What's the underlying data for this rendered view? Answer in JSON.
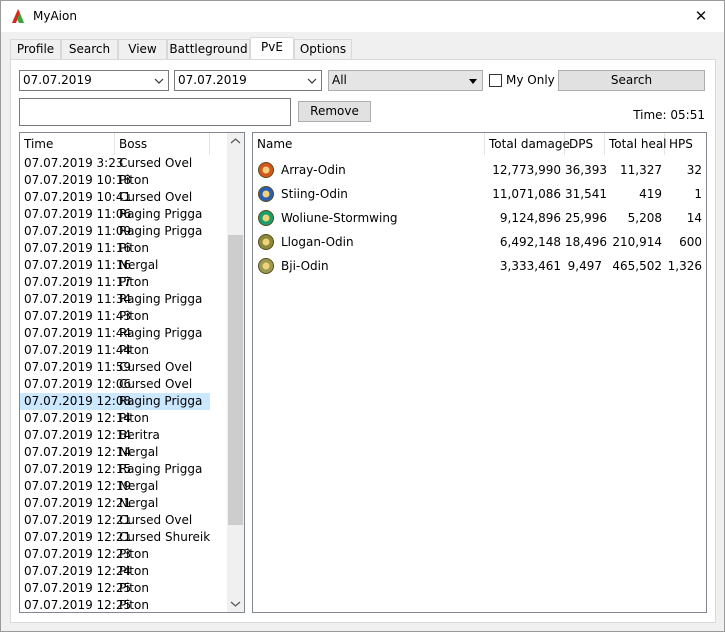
{
  "window": {
    "title": "MyAion",
    "close_glyph": "✕"
  },
  "tabs": [
    {
      "label": "Profile"
    },
    {
      "label": "Search"
    },
    {
      "label": "View"
    },
    {
      "label": "Battleground"
    },
    {
      "label": "PvE"
    },
    {
      "label": "Options"
    }
  ],
  "active_tab": "PvE",
  "filters": {
    "date_from": "07.07.2019",
    "date_to": "07.07.2019",
    "boss_filter": "All",
    "my_only_label": "My Only",
    "my_only_checked": false,
    "search_label": "Search",
    "remove_label": "Remove",
    "text_value": "",
    "time_label": "Time: 05:51"
  },
  "fight_list": {
    "headers": [
      "Time",
      "Boss"
    ],
    "sort_indicator": "˄",
    "selected_index": 14,
    "rows": [
      [
        "07.07.2019 3:23",
        "Cursed Ovel"
      ],
      [
        "07.07.2019 10:18",
        "Piton"
      ],
      [
        "07.07.2019 10:41",
        "Cursed Ovel"
      ],
      [
        "07.07.2019 11:06",
        "Raging Prigga"
      ],
      [
        "07.07.2019 11:09",
        "Raging Prigga"
      ],
      [
        "07.07.2019 11:16",
        "Piton"
      ],
      [
        "07.07.2019 11:16",
        "Nergal"
      ],
      [
        "07.07.2019 11:17",
        "Piton"
      ],
      [
        "07.07.2019 11:34",
        "Raging Prigga"
      ],
      [
        "07.07.2019 11:43",
        "Piton"
      ],
      [
        "07.07.2019 11:44",
        "Raging Prigga"
      ],
      [
        "07.07.2019 11:44",
        "Piton"
      ],
      [
        "07.07.2019 11:59",
        "Cursed Ovel"
      ],
      [
        "07.07.2019 12:06",
        "Cursed Ovel"
      ],
      [
        "07.07.2019 12:08",
        "Raging Prigga"
      ],
      [
        "07.07.2019 12:14",
        "Piton"
      ],
      [
        "07.07.2019 12:14",
        "Beritra"
      ],
      [
        "07.07.2019 12:14",
        "Nergal"
      ],
      [
        "07.07.2019 12:15",
        "Raging Prigga"
      ],
      [
        "07.07.2019 12:19",
        "Nergal"
      ],
      [
        "07.07.2019 12:21",
        "Nergal"
      ],
      [
        "07.07.2019 12:21",
        "Cursed Ovel"
      ],
      [
        "07.07.2019 12:21",
        "Cursed Shureik"
      ],
      [
        "07.07.2019 12:23",
        "Piton"
      ],
      [
        "07.07.2019 12:24",
        "Piton"
      ],
      [
        "07.07.2019 12:25",
        "Piton"
      ],
      [
        "07.07.2019 12:25",
        "Piton"
      ]
    ],
    "scroll_position": 0.55
  },
  "stats": {
    "headers": [
      "Name",
      "Total damage",
      "DPS",
      "Total heal",
      "HPS"
    ],
    "rows": [
      {
        "icon": "assassin-class-icon",
        "color": "#d4581e",
        "name": "Array-Odin",
        "damage": "12,773,990",
        "dps": "36,393",
        "heal": "11,327",
        "hps": "32"
      },
      {
        "icon": "sorcerer-class-icon",
        "color": "#2a5fb4",
        "name": "Stiing-Odin",
        "damage": "11,071,086",
        "dps": "31,541",
        "heal": "419",
        "hps": "1"
      },
      {
        "icon": "ranger-class-icon",
        "color": "#1aa06a",
        "name": "Woliune-Stormwing",
        "damage": "9,124,896",
        "dps": "25,996",
        "heal": "5,208",
        "hps": "14"
      },
      {
        "icon": "chanter-class-icon",
        "color": "#8a8a3a",
        "name": "Llogan-Odin",
        "damage": "6,492,148",
        "dps": "18,496",
        "heal": "210,914",
        "hps": "600"
      },
      {
        "icon": "cleric-class-icon",
        "color": "#9a9a50",
        "name": "Bji-Odin",
        "damage": "3,333,461",
        "dps": "9,497",
        "heal": "465,502",
        "hps": "1,326"
      }
    ]
  }
}
